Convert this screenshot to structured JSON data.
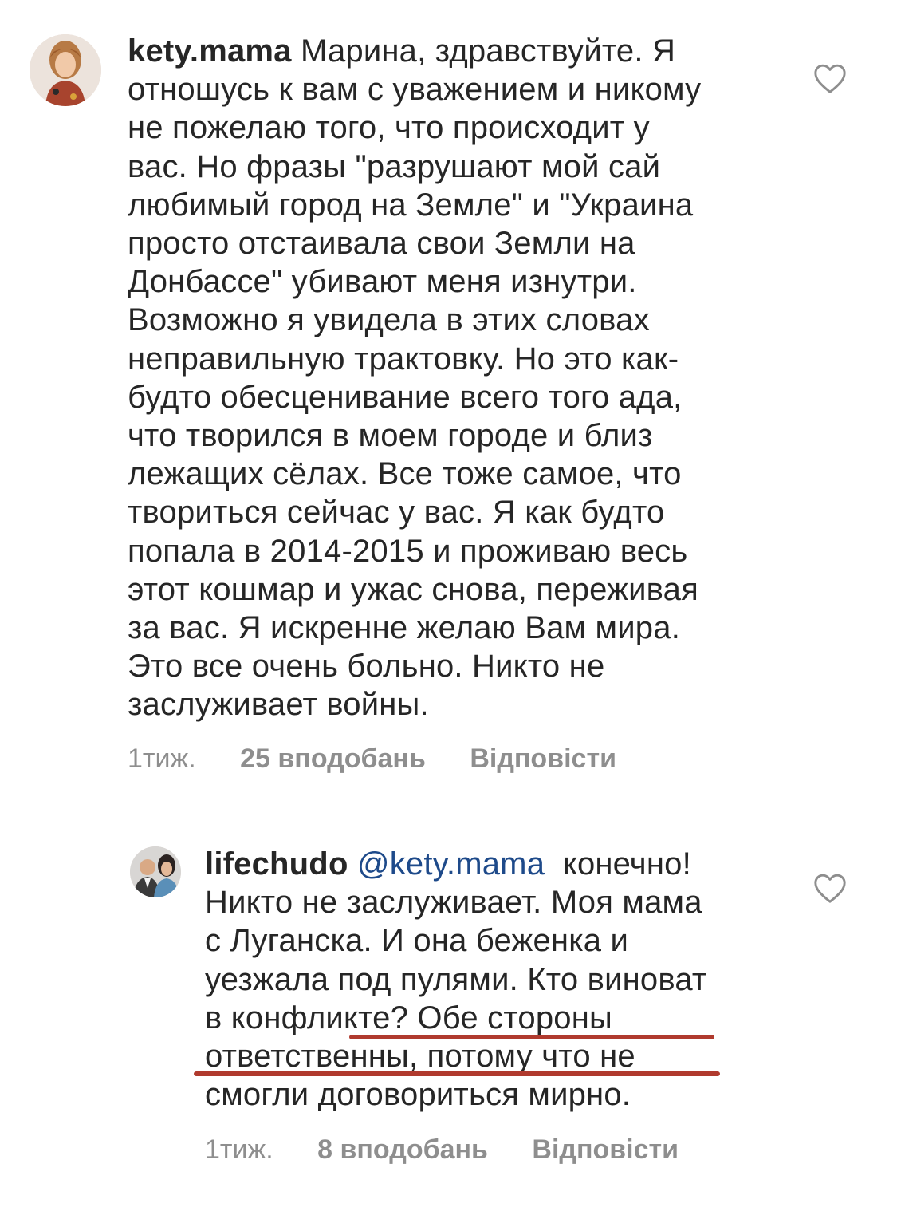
{
  "comments": [
    {
      "username": "kety.mama",
      "lines": [
        "Марина, здравствуйте. Я",
        "отношусь к вам с уважением и никому",
        "не пожелаю того, что происходит у",
        "вас. Но фразы \"разрушают мой сай",
        "любимый город на Земле\" и \"Украина",
        "просто отстаивала свои Земли на",
        "Донбассе\" убивают меня изнутри.",
        "Возможно я увидела в этих словах",
        "неправильную трактовку. Но это как-",
        "будто обесценивание всего того ада,",
        "что творился в моем городе и близ",
        "лежащих сёлах. Все тоже самое, что",
        "твориться сейчас у вас. Я как будто",
        "попала в 2014-2015 и проживаю весь",
        "этот кошмар и ужас снова, переживая",
        "за вас. Я искренне желаю Вам мира.",
        "Это все очень больно. Никто не",
        "заслуживает войны."
      ],
      "time": "1тиж.",
      "likes": "25 вподобань",
      "reply": "Відповісти",
      "avatar_icon": "profile-photo-woman",
      "like_icon": "heart-outline-icon"
    },
    {
      "username": "lifechudo",
      "mention": "@kety.mama",
      "lines": [
        "конечно!",
        "Никто не заслуживает. Моя мама",
        "с Луганска. И она беженка и",
        "уезжала под пулями. Кто виноват",
        "в конфликте? Обе стороны",
        "ответственны, потому что не",
        "смогли договориться мирно."
      ],
      "time": "1тиж.",
      "likes": "8 вподобань",
      "reply": "Відповісти",
      "avatar_icon": "profile-photo-couple",
      "like_icon": "heart-outline-icon"
    }
  ],
  "colors": {
    "text": "#262626",
    "meta": "#8e8e8e",
    "mention": "#1e4a8a",
    "highlight_underline": "#b03a2e"
  }
}
